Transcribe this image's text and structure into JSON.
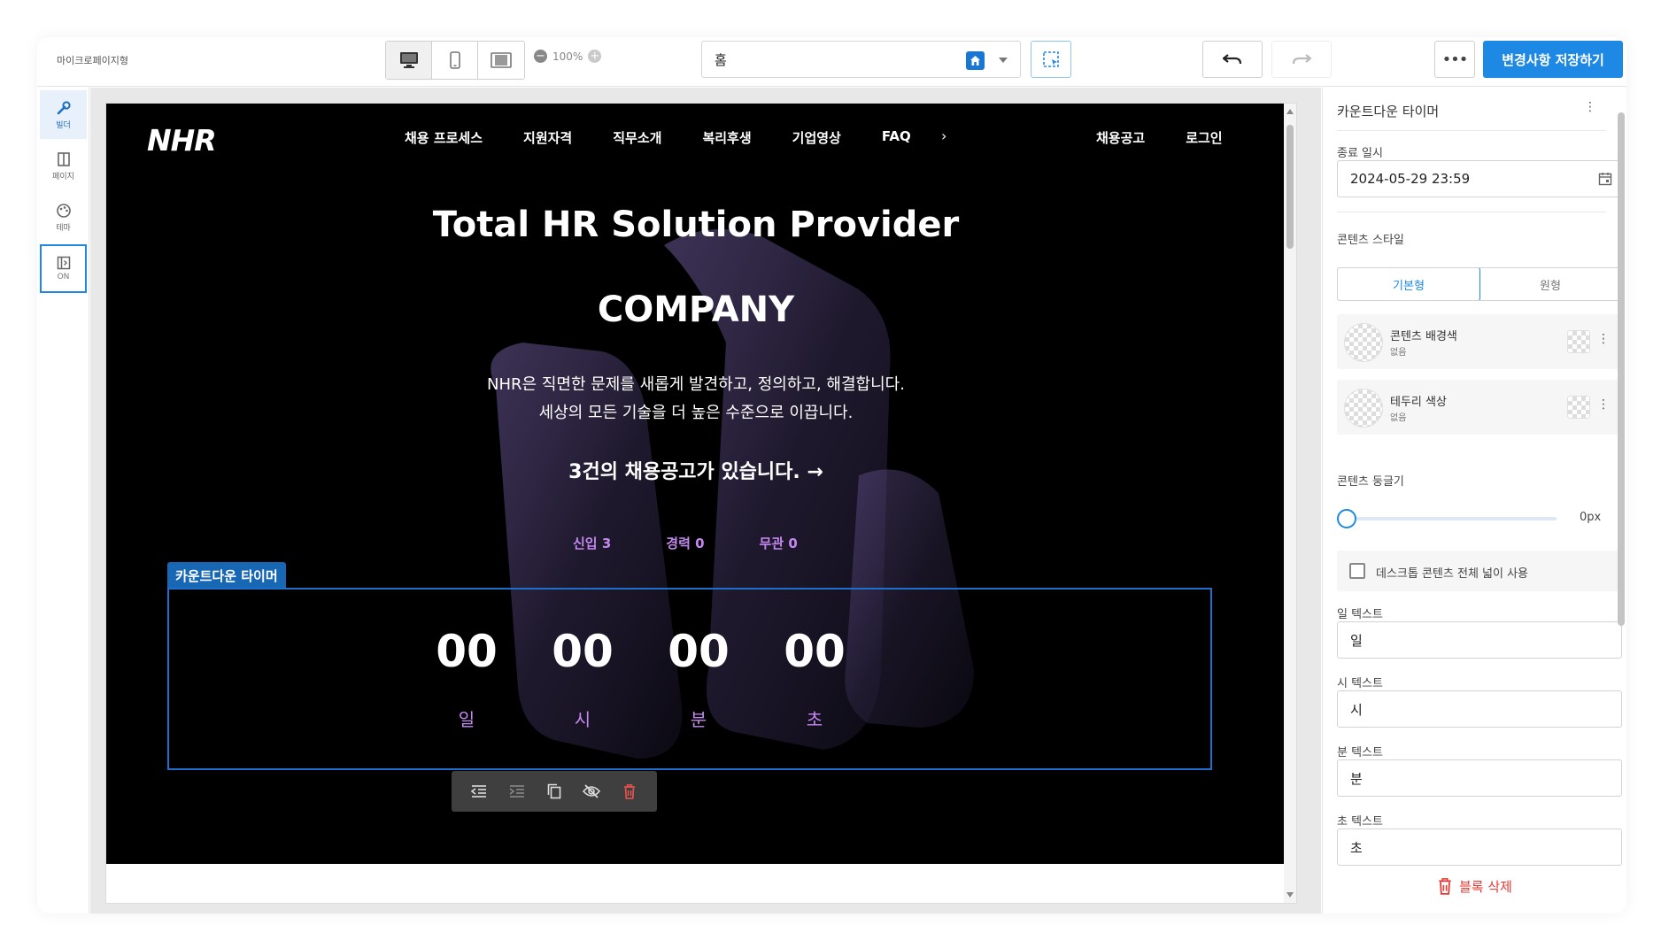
{
  "app": {
    "title": "마이크로페이지형"
  },
  "toolbar": {
    "zoom_level": "100%",
    "page_select": "홈",
    "save_label": "변경사항 저장하기"
  },
  "rail": {
    "items": [
      {
        "label": "빌더"
      },
      {
        "label": "페이지"
      },
      {
        "label": "테마"
      },
      {
        "label": "ON"
      }
    ]
  },
  "site": {
    "logo": "NHR",
    "menu": [
      "채용 프로세스",
      "지원자격",
      "직무소개",
      "복리후생",
      "기업영상",
      "FAQ"
    ],
    "menu_more": "›",
    "nav_right": [
      "채용공고",
      "로그인"
    ],
    "hero_title": "Total HR Solution Provider",
    "hero_subtitle": "COMPANY",
    "desc_line1": "NHR은 직면한 문제를 새롭게 발견하고, 정의하고, 해결합니다.",
    "desc_line2": "세상의 모든 기술을 더 높은 수준으로 이끕니다.",
    "jobs_text": "3건의 채용공고가 있습니다. →",
    "categories": [
      "신입 3",
      "경력 0",
      "무관 0"
    ]
  },
  "countdown": {
    "tag": "카운트다운 타이머",
    "days": "00",
    "hours": "00",
    "minutes": "00",
    "seconds": "00",
    "label_days": "일",
    "label_hours": "시",
    "label_minutes": "분",
    "label_seconds": "초"
  },
  "panel": {
    "title": "카운트다운 타이머",
    "end_label": "종료 일시",
    "end_value": "2024-05-29 23:59",
    "style_label": "콘텐츠 스타일",
    "style_options": [
      "기본형",
      "원형"
    ],
    "bg_color_name": "콘텐츠 배경색",
    "bg_color_value": "없음",
    "border_color_name": "테두리 색상",
    "border_color_value": "없음",
    "radius_label": "콘텐츠 둥글기",
    "radius_value": "0px",
    "full_width_label": "데스크톱 콘텐츠 전체 넓이 사용",
    "day_text_label": "일 텍스트",
    "day_text_value": "일",
    "hour_text_label": "시 텍스트",
    "hour_text_value": "시",
    "minute_text_label": "분 텍스트",
    "minute_text_value": "분",
    "second_text_label": "초 텍스트",
    "second_text_value": "초",
    "delete_label": "블록 삭제"
  },
  "colors": {
    "accent": "#1e88e5",
    "label_purple": "#c488f0",
    "danger": "#e53935"
  }
}
